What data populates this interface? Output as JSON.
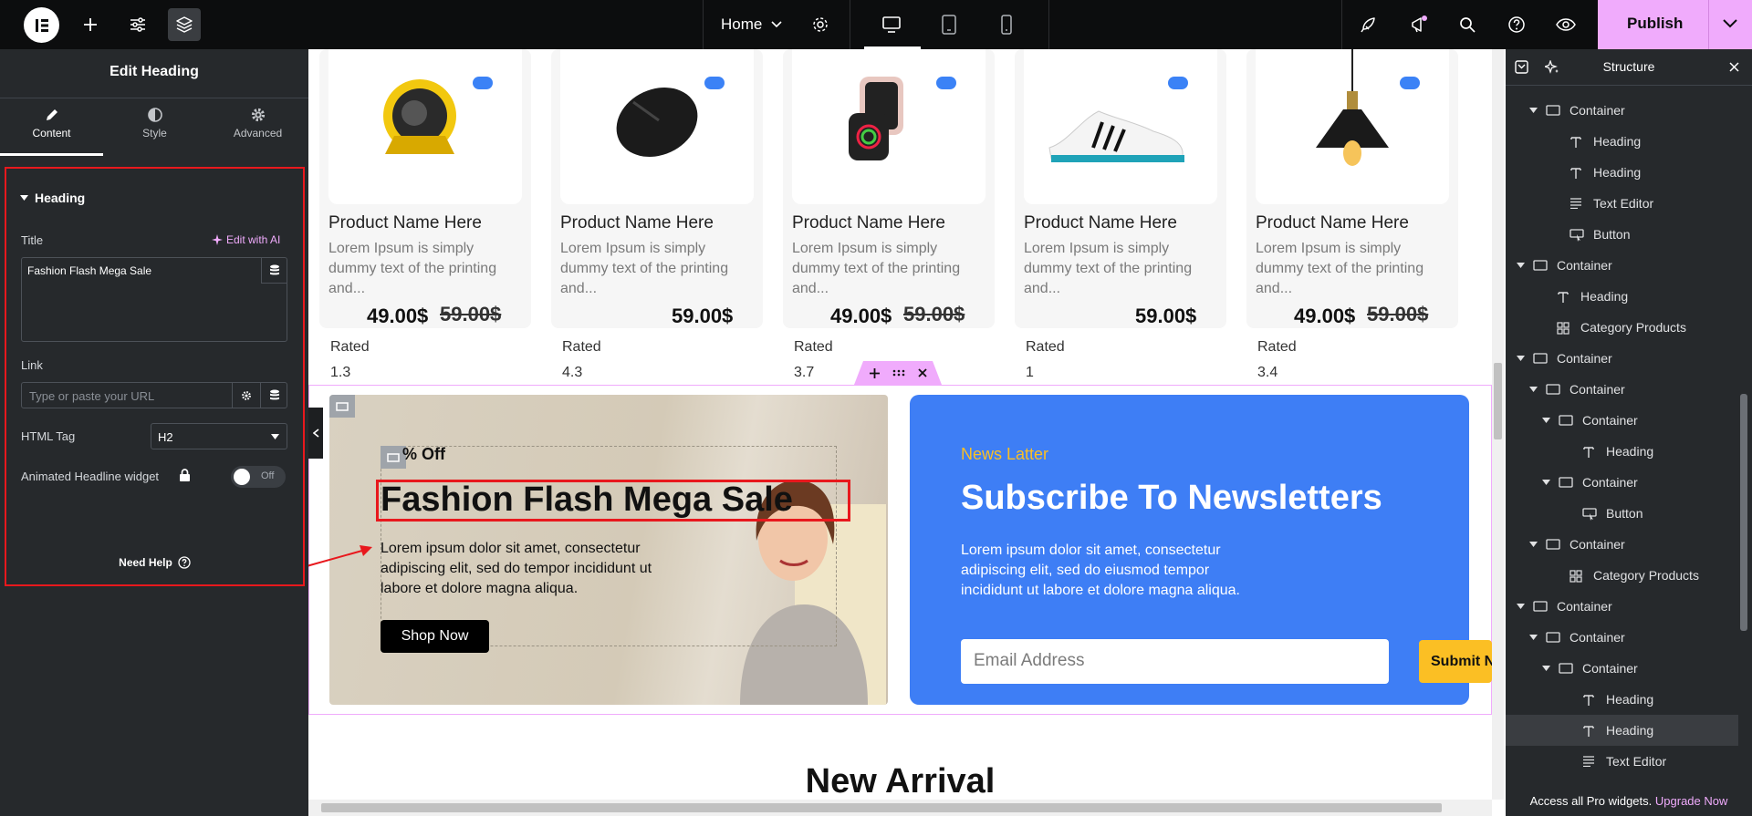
{
  "topbar": {
    "page_name": "Home",
    "publish_label": "Publish",
    "colors": {
      "bg": "#0c0d0e",
      "publish": "#f0abfc"
    },
    "icons": [
      "elementor-logo-icon",
      "add-element-icon",
      "site-settings-icon",
      "structure-layers-icon",
      "chevron-down-icon",
      "page-settings-icon",
      "desktop-icon",
      "tablet-icon",
      "mobile-icon",
      "rocket-icon",
      "whats-new-icon",
      "search-icon",
      "help-icon",
      "preview-eye-icon",
      "publish-chevron-icon"
    ]
  },
  "left_panel": {
    "title": "Edit Heading",
    "tabs": [
      {
        "label": "Content",
        "icon": "pencil-icon",
        "active": true
      },
      {
        "label": "Style",
        "icon": "half-circle-icon",
        "active": false
      },
      {
        "label": "Advanced",
        "icon": "gear-icon",
        "active": false
      }
    ],
    "section_title": "Heading",
    "title_label": "Title",
    "edit_ai": "Edit with AI",
    "title_value": "Fashion Flash Mega Sale",
    "link_label": "Link",
    "link_placeholder": "Type or paste your URL",
    "html_tag_label": "HTML Tag",
    "html_tag_value": "H2",
    "animated_label": "Animated Headline widget",
    "toggle_state": "Off",
    "need_help": "Need Help"
  },
  "products": [
    {
      "name": "Product Name Here",
      "desc": "Lorem Ipsum is simply dummy text of the printing and...",
      "price": "49.00$",
      "old_price": "59.00$",
      "rated_label": "Rated",
      "rating": "1.3"
    },
    {
      "name": "Product Name Here",
      "desc": "Lorem Ipsum is simply dummy text of the printing and...",
      "price": "59.00$",
      "old_price": "",
      "rated_label": "Rated",
      "rating": "4.3"
    },
    {
      "name": "Product Name Here",
      "desc": "Lorem Ipsum is simply dummy text of the printing and...",
      "price": "49.00$",
      "old_price": "59.00$",
      "rated_label": "Rated",
      "rating": "3.7"
    },
    {
      "name": "Product Name Here",
      "desc": "Lorem Ipsum is simply dummy text of the printing and...",
      "price": "59.00$",
      "old_price": "",
      "rated_label": "Rated",
      "rating": "1"
    },
    {
      "name": "Product Name Here",
      "desc": "Lorem Ipsum is simply dummy text of the printing and...",
      "price": "49.00$",
      "old_price": "59.00$",
      "rated_label": "Rated",
      "rating": "3.4"
    }
  ],
  "promo": {
    "badge": "% Off",
    "heading": "Fashion Flash Mega Sale",
    "text": "Lorem ipsum dolor sit amet, consectetur adipiscing elit, sed do tempor incididunt ut labore et dolore magna aliqua.",
    "button": "Shop Now"
  },
  "newsletter": {
    "kicker": "News Latter",
    "heading": "Subscribe To Newsletters",
    "text": "Lorem ipsum dolor sit amet, consectetur adipiscing elit, sed do eiusmod tempor incididunt ut labore et dolore magna aliqua.",
    "email_placeholder": "Email Address",
    "submit": "Submit N",
    "colors": {
      "bg": "#3e7ef5",
      "kicker": "#fbbf24",
      "button": "#fbbf24"
    }
  },
  "new_arrival": "New Arrival",
  "structure": {
    "title": "Structure",
    "items": [
      {
        "label": "Container",
        "type": "container",
        "depth": 2,
        "caret": true
      },
      {
        "label": "Heading",
        "type": "heading",
        "depth": 3
      },
      {
        "label": "Heading",
        "type": "heading",
        "depth": 3
      },
      {
        "label": "Text Editor",
        "type": "text",
        "depth": 3
      },
      {
        "label": "Button",
        "type": "button",
        "depth": 3
      },
      {
        "label": "Container",
        "type": "container",
        "depth": 1,
        "caret": true
      },
      {
        "label": "Heading",
        "type": "heading",
        "depth": 2
      },
      {
        "label": "Category Products",
        "type": "grid",
        "depth": 2
      },
      {
        "label": "Container",
        "type": "container",
        "depth": 1,
        "caret": true
      },
      {
        "label": "Container",
        "type": "container",
        "depth": 2,
        "caret": true
      },
      {
        "label": "Container",
        "type": "container",
        "depth": 3,
        "caret": true
      },
      {
        "label": "Heading",
        "type": "heading",
        "depth": 4
      },
      {
        "label": "Container",
        "type": "container",
        "depth": 3,
        "caret": true
      },
      {
        "label": "Button",
        "type": "button",
        "depth": 4
      },
      {
        "label": "Container",
        "type": "container",
        "depth": 2,
        "caret": true
      },
      {
        "label": "Category Products",
        "type": "grid",
        "depth": 3
      },
      {
        "label": "Container",
        "type": "container",
        "depth": 1,
        "caret": true
      },
      {
        "label": "Container",
        "type": "container",
        "depth": 2,
        "caret": true
      },
      {
        "label": "Container",
        "type": "container",
        "depth": 3,
        "caret": true
      },
      {
        "label": "Heading",
        "type": "heading",
        "depth": 4
      },
      {
        "label": "Heading",
        "type": "heading",
        "depth": 4,
        "selected": true
      },
      {
        "label": "Text Editor",
        "type": "text",
        "depth": 4
      }
    ],
    "footer_text": "Access all Pro widgets.",
    "footer_link": "Upgrade Now"
  }
}
